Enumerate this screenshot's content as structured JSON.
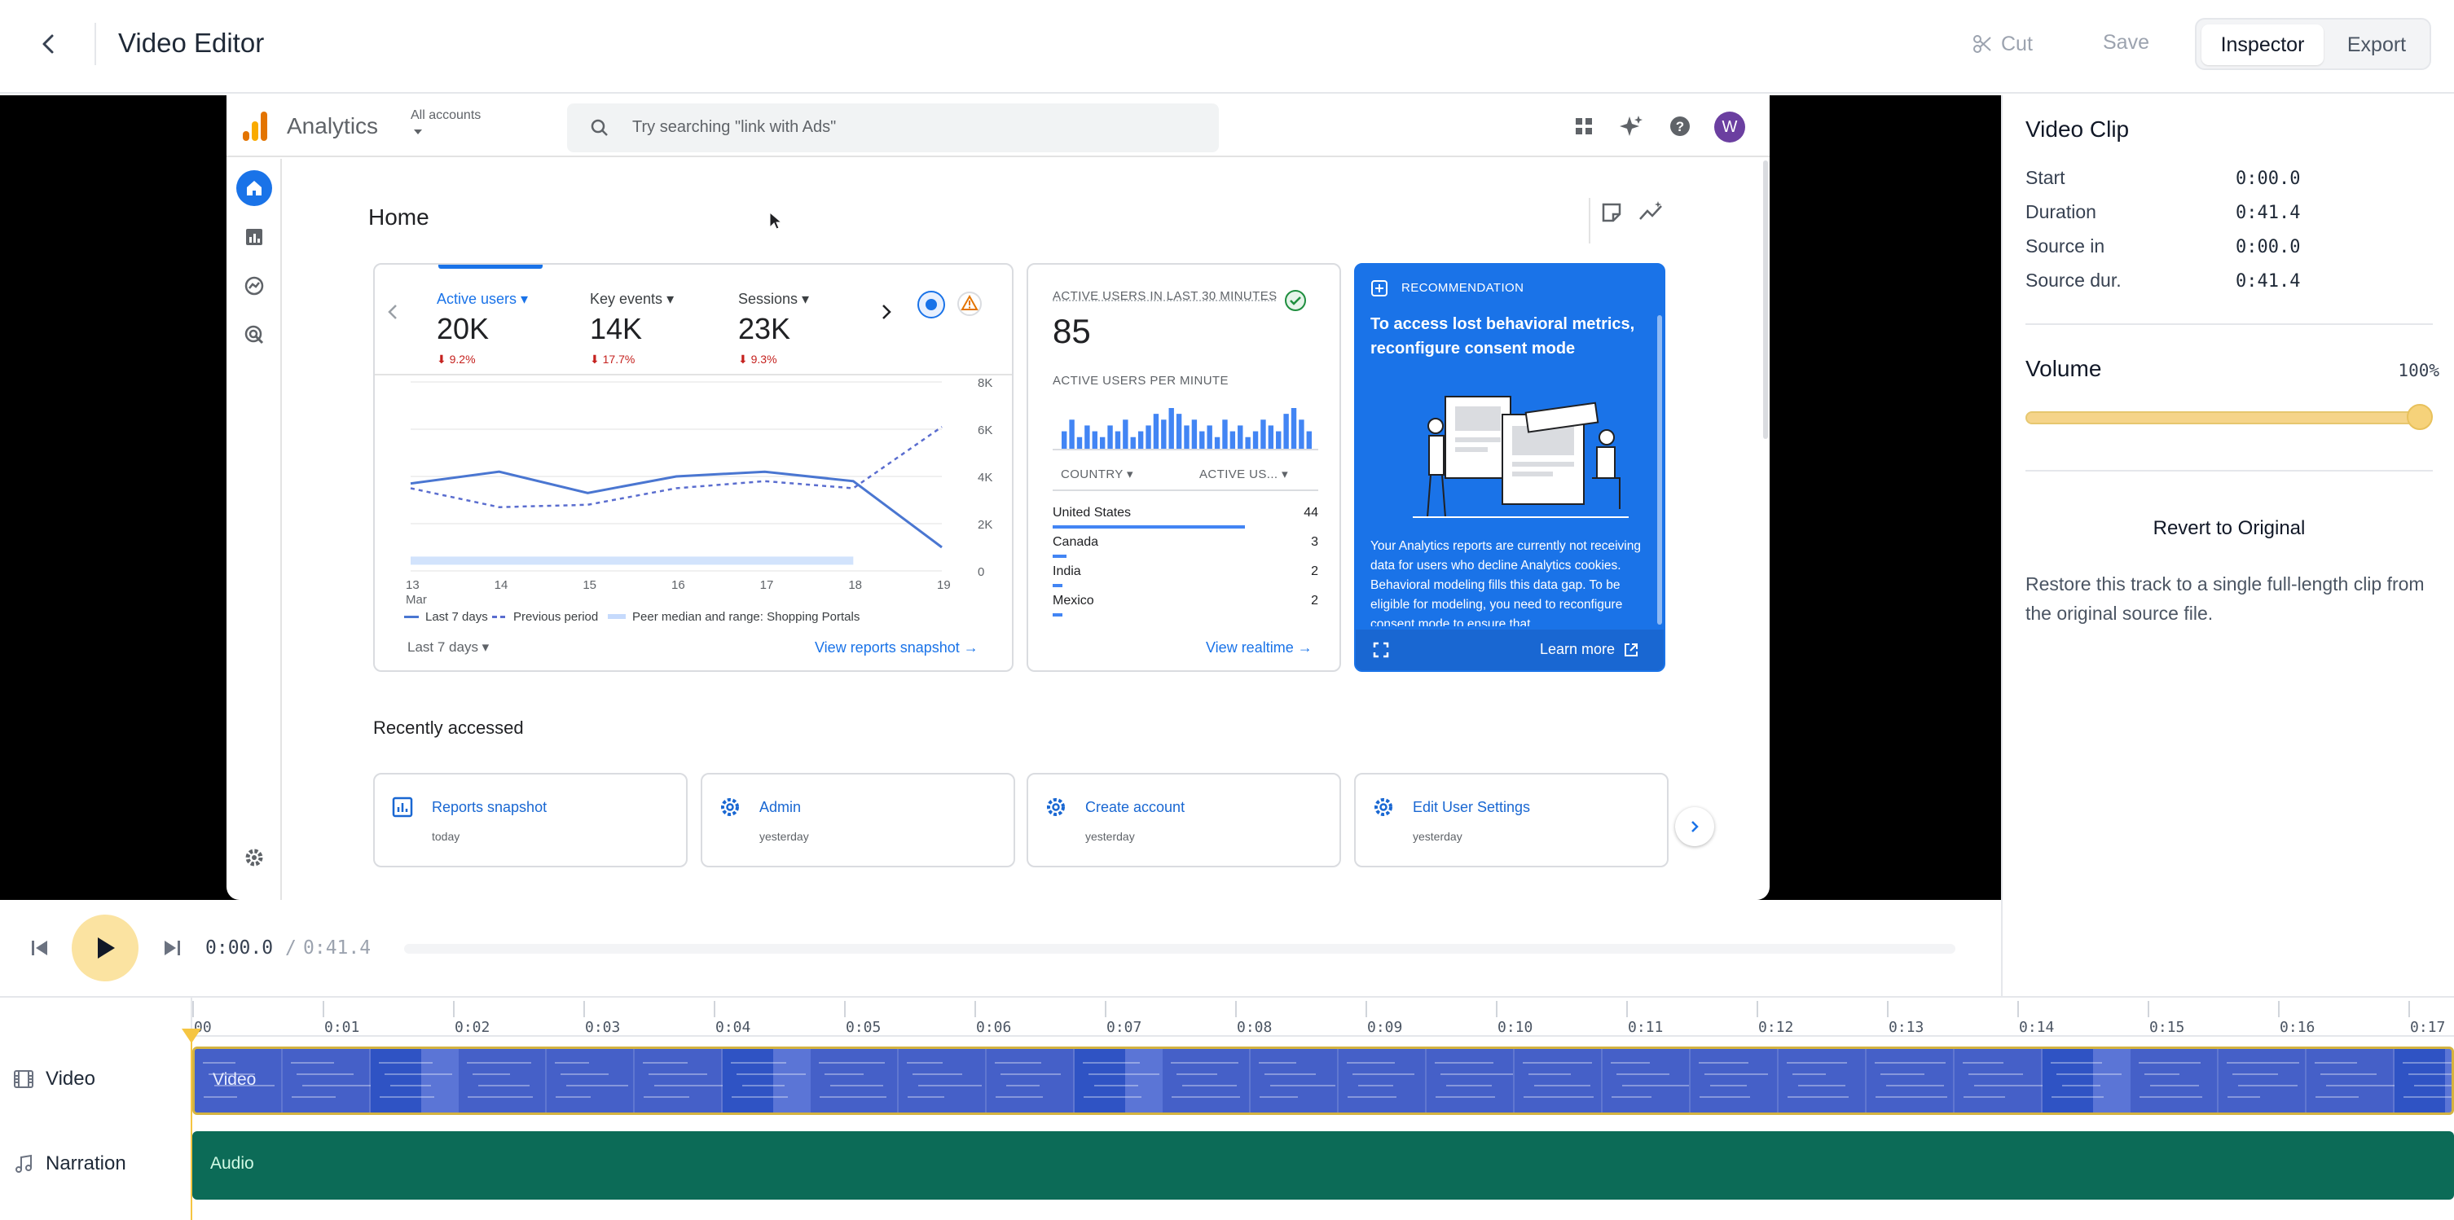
{
  "header": {
    "title": "Video Editor",
    "cut_label": "Cut",
    "save_label": "Save",
    "tabs": [
      {
        "label": "Inspector",
        "active": true
      },
      {
        "label": "Export",
        "active": false
      }
    ]
  },
  "preview": {
    "analytics": {
      "brand": "Analytics",
      "accounts": "All accounts",
      "search_placeholder": "Try searching \"link with Ads\"",
      "avatar_letter": "W",
      "page_title": "Home",
      "metrics": [
        {
          "label": "Active users",
          "value": "20K",
          "delta": "9.2%"
        },
        {
          "label": "Key events",
          "value": "14K",
          "delta": "17.7%"
        },
        {
          "label": "Sessions",
          "value": "23K",
          "delta": "9.3%"
        }
      ],
      "chart_data": {
        "type": "line",
        "x": [
          "13 Mar",
          "14",
          "15",
          "16",
          "17",
          "18",
          "19"
        ],
        "x_ticks": [
          "13",
          "14",
          "15",
          "16",
          "17",
          "18",
          "19"
        ],
        "x_sublabel": "Mar",
        "y_ticks": [
          "8K",
          "6K",
          "4K",
          "2K",
          "0"
        ],
        "ylim": [
          0,
          8000
        ],
        "series": [
          {
            "name": "Last 7 days",
            "values": [
              3700,
              4200,
              3300,
              4000,
              4200,
              3800,
              1000
            ]
          },
          {
            "name": "Previous period",
            "values": [
              3500,
              2700,
              2800,
              3500,
              3800,
              3500,
              6100
            ]
          },
          {
            "name": "Peer median and range: Shopping Portals",
            "values": [
              400,
              400,
              400,
              400,
              400,
              400,
              null
            ]
          }
        ],
        "legend": [
          "Last 7 days",
          "Previous period",
          "Peer median and range: Shopping Portals"
        ]
      },
      "range_label": "Last 7 days",
      "snapshot_link": "View reports snapshot",
      "realtime": {
        "title": "ACTIVE USERS IN LAST 30 MINUTES",
        "value": "85",
        "per_minute_label": "ACTIVE USERS PER MINUTE",
        "col_country": "COUNTRY",
        "col_users": "ACTIVE US...",
        "per_minute_values": [
          3,
          5,
          2,
          4,
          3,
          2,
          4,
          3,
          5,
          2,
          3,
          4,
          6,
          5,
          7,
          6,
          4,
          5,
          3,
          4,
          2,
          5,
          3,
          4,
          2,
          3,
          5,
          4,
          3,
          6,
          7,
          5,
          3
        ],
        "rows": [
          {
            "country": "United States",
            "value": "44",
            "share": 1.0
          },
          {
            "country": "Canada",
            "value": "3",
            "share": 0.07
          },
          {
            "country": "India",
            "value": "2",
            "share": 0.05
          },
          {
            "country": "Mexico",
            "value": "2",
            "share": 0.05
          }
        ],
        "link": "View realtime"
      },
      "recommendation": {
        "label": "RECOMMENDATION",
        "title": "To access lost behavioral metrics, reconfigure consent mode",
        "body": "Your Analytics reports are currently not receiving data for users who decline Analytics cookies. Behavioral modeling fills this data gap. To be eligible for modeling, you need to reconfigure consent mode to ensure that",
        "learn_more": "Learn more"
      },
      "recently_accessed_title": "Recently accessed",
      "recently_accessed": [
        {
          "name": "Reports snapshot",
          "when": "today",
          "icon": "bar-chart-icon"
        },
        {
          "name": "Admin",
          "when": "yesterday",
          "icon": "gear-icon"
        },
        {
          "name": "Create account",
          "when": "yesterday",
          "icon": "gear-icon"
        },
        {
          "name": "Edit User Settings",
          "when": "yesterday",
          "icon": "gear-icon"
        }
      ]
    }
  },
  "transport": {
    "current_time": "0:00.0",
    "separator": "/",
    "total_time": "0:41.4",
    "progress": 0
  },
  "inspector": {
    "title": "Video Clip",
    "props": [
      {
        "label": "Start",
        "value": "0:00.0"
      },
      {
        "label": "Duration",
        "value": "0:41.4"
      },
      {
        "label": "Source in",
        "value": "0:00.0"
      },
      {
        "label": "Source dur.",
        "value": "0:41.4"
      }
    ],
    "volume_title": "Volume",
    "volume_value": "100%",
    "volume_level": 1.0,
    "revert_label": "Revert to Original",
    "revert_desc": "Restore this track to a single full-length clip from the original source file."
  },
  "timeline": {
    "ticks": [
      "00",
      "0:01",
      "0:02",
      "0:03",
      "0:04",
      "0:05",
      "0:06",
      "0:07",
      "0:08",
      "0:09",
      "0:10",
      "0:11",
      "0:12",
      "0:13",
      "0:14",
      "0:15",
      "0:16",
      "0:17"
    ],
    "tracks": [
      {
        "name": "Video",
        "clip_label": "Video",
        "icon": "film-icon"
      },
      {
        "name": "Narration",
        "clip_label": "Audio",
        "icon": "music-note-icon"
      }
    ]
  },
  "colors": {
    "accent": "#f5c542",
    "video_clip": "#5b75d6",
    "audio_clip": "#0c6b57",
    "ga_blue": "#1a73e8"
  }
}
